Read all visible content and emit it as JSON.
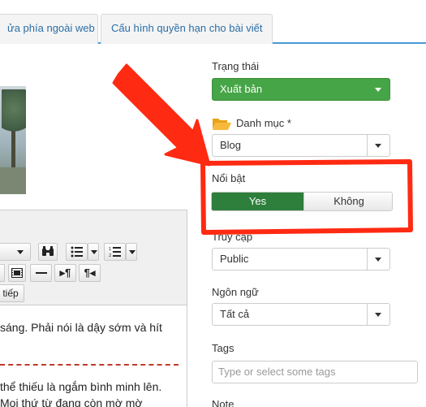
{
  "tabs": [
    {
      "label": "ửa phía ngoài web"
    },
    {
      "label": "Cấu hình quyền hạn cho bài viết"
    }
  ],
  "editor": {
    "toolbar": {
      "continue_label": "tiếp"
    },
    "content_lines": [
      "sáng. Phải nói là dậy sớm và hít",
      "thể thiếu là ngắm bình minh lên.",
      "Mọi thứ từ đang còn mờ mờ"
    ]
  },
  "sidebar": {
    "status": {
      "label": "Trạng thái",
      "value": "Xuất bản"
    },
    "category": {
      "label": "Danh mục *",
      "value": "Blog"
    },
    "featured": {
      "label": "Nổi bật",
      "yes": "Yes",
      "no": "Không"
    },
    "access": {
      "label": "Truy cập",
      "value": "Public"
    },
    "language": {
      "label": "Ngôn ngữ",
      "value": "Tất cả"
    },
    "tags": {
      "label": "Tags",
      "placeholder": "Type or select some tags"
    },
    "note": {
      "label": "Note"
    }
  },
  "colors": {
    "status_green": "#46a546",
    "toggle_green": "#2d7f3b",
    "annotation_red": "#ff2a12",
    "tab_link": "#2a6ea6"
  },
  "icons": [
    "folder-icon",
    "bold-icon",
    "unordered-list-icon",
    "ordered-list-icon",
    "horizontal-rule-icon",
    "paragraph-ltr-icon",
    "paragraph-rtl-icon",
    "media-icon",
    "chevron-down-icon"
  ]
}
